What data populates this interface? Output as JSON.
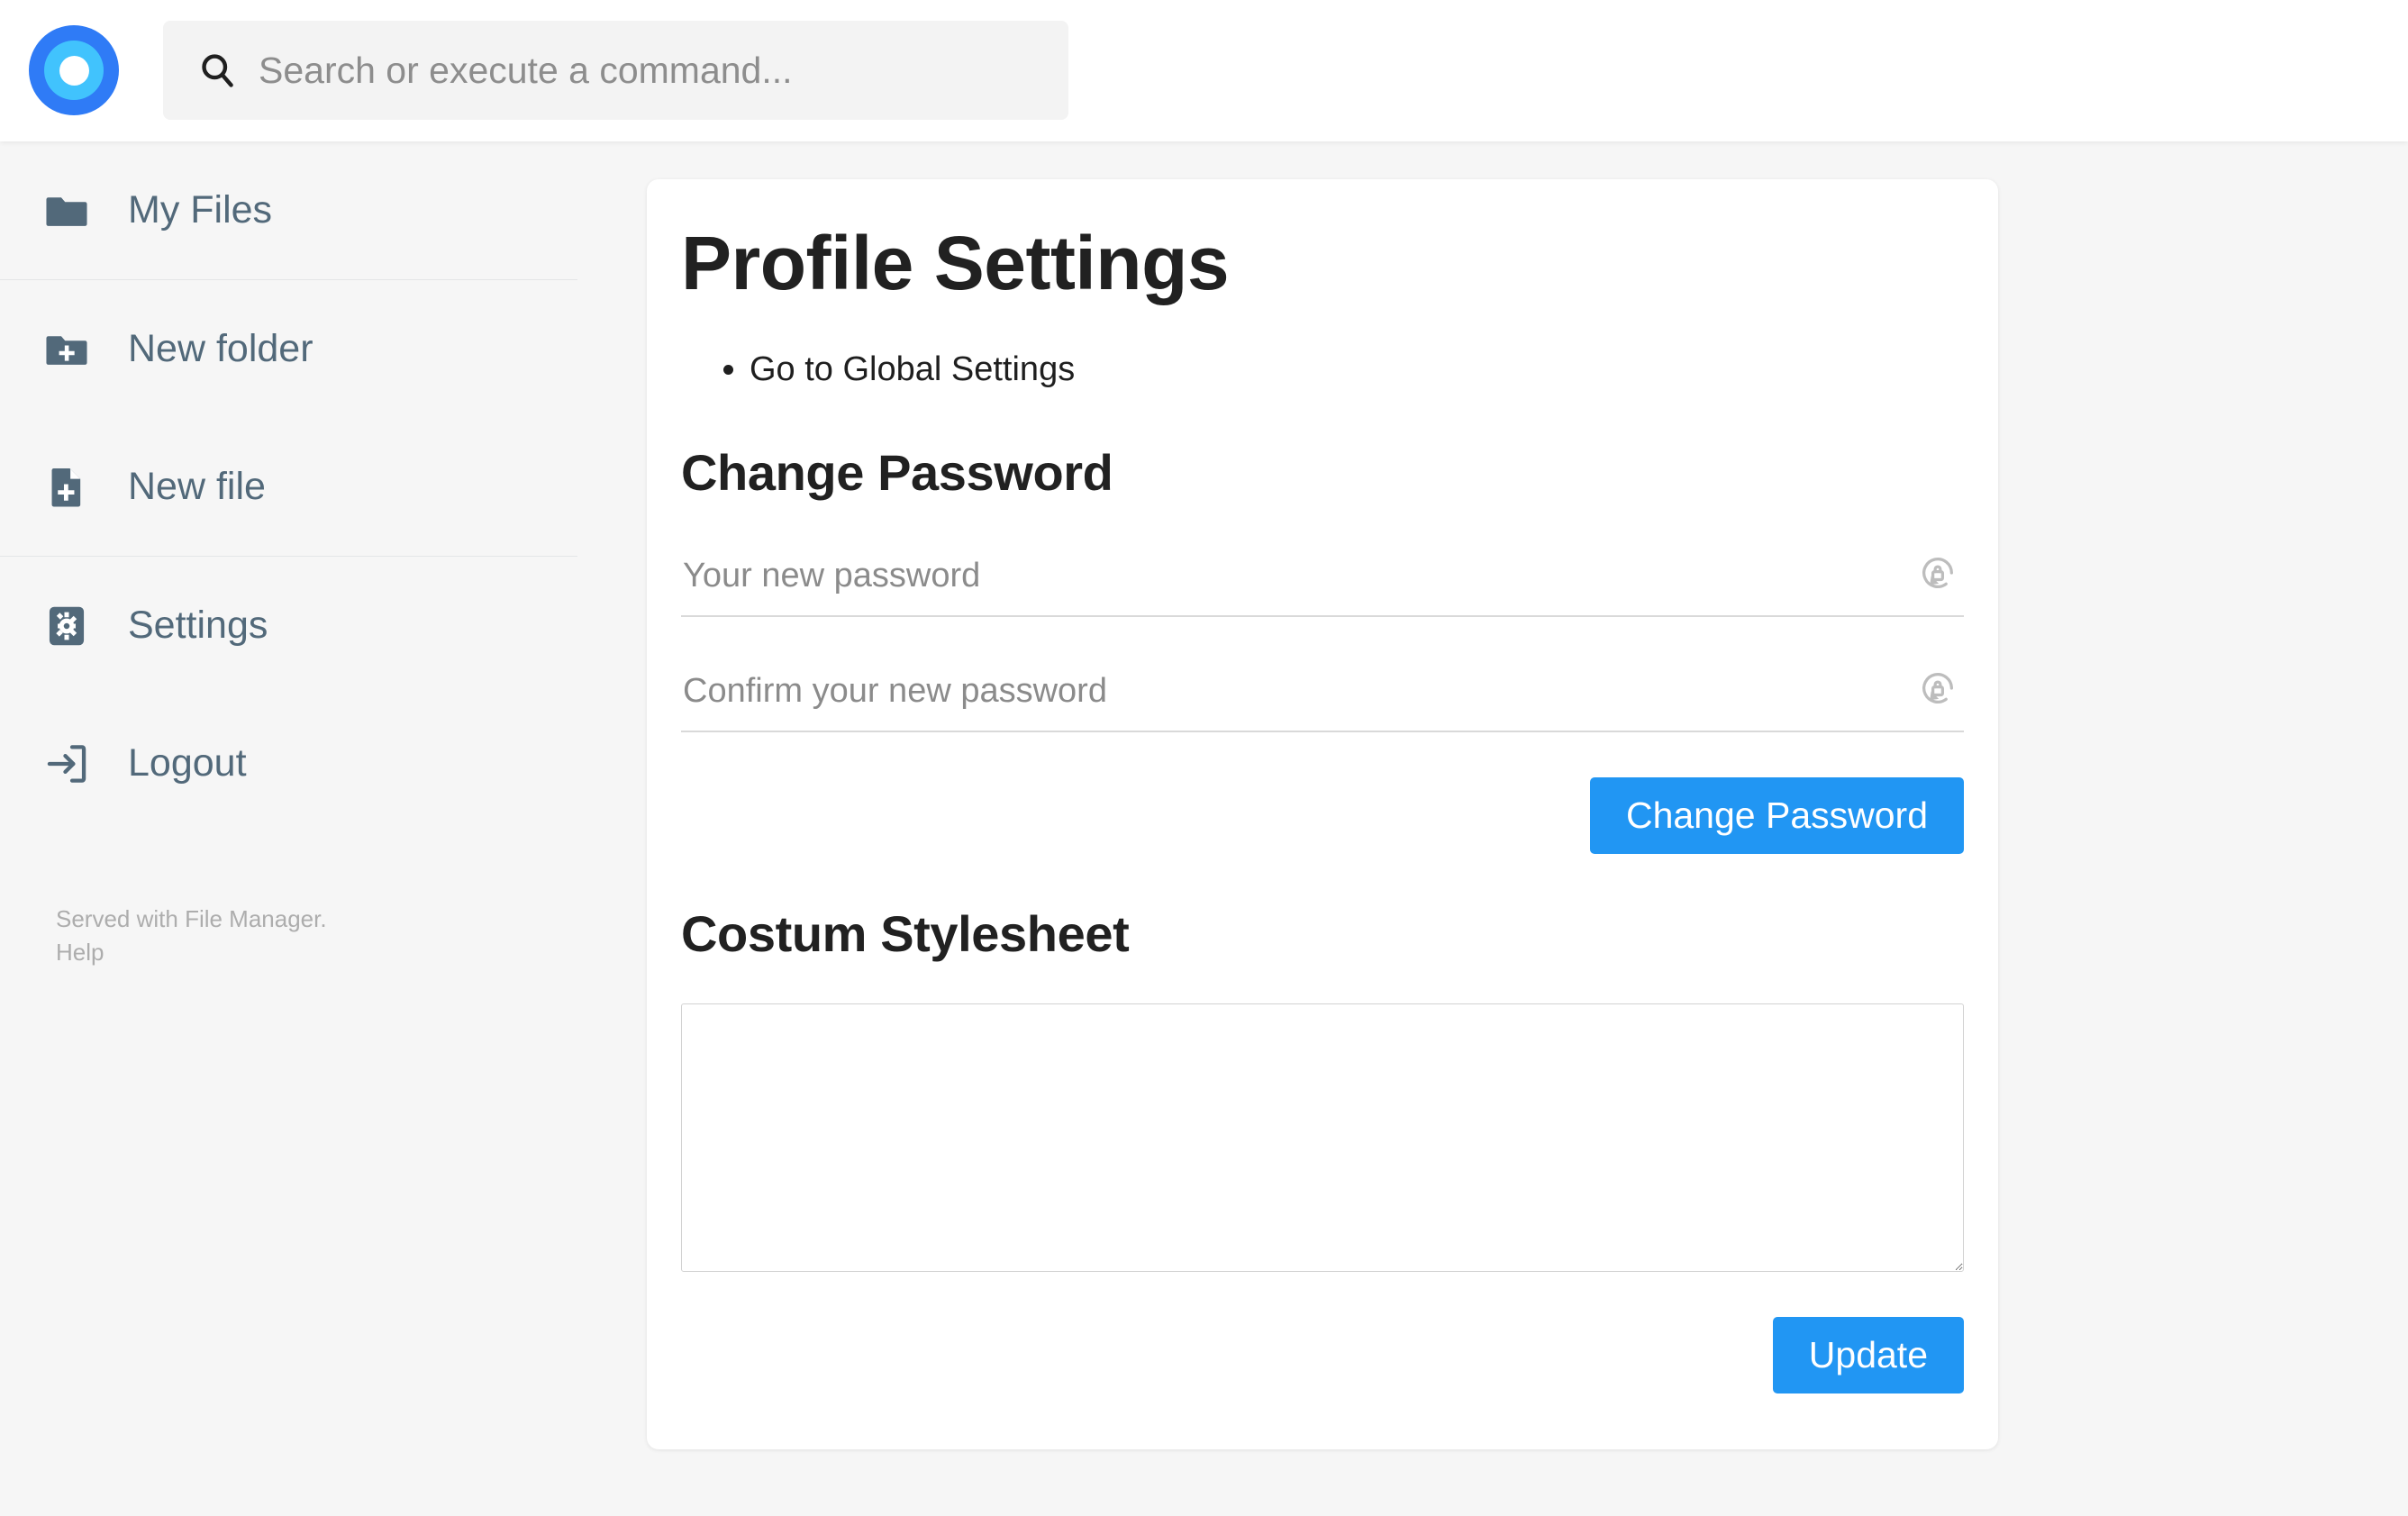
{
  "topbar": {
    "logo_name": "file-manager-logo",
    "logo_colors": {
      "outer_ring": "#2f7bf6",
      "inner_ring": "#41c3fd",
      "core": "#ffffff"
    },
    "search": {
      "placeholder": "Search or execute a command...",
      "value": "",
      "icon": "search-icon"
    }
  },
  "sidebar": {
    "items": [
      {
        "label": "My Files",
        "icon": "folder-icon"
      },
      {
        "label": "New folder",
        "icon": "folder-plus-icon"
      },
      {
        "label": "New file",
        "icon": "file-plus-icon"
      },
      {
        "label": "Settings",
        "icon": "gear-icon"
      },
      {
        "label": "Logout",
        "icon": "logout-icon"
      }
    ],
    "footer": {
      "served_with": "Served with File Manager.",
      "help": "Help"
    }
  },
  "main": {
    "page_title": "Profile Settings",
    "links": [
      {
        "label": "Go to Global Settings"
      }
    ],
    "change_password": {
      "heading": "Change Password",
      "new_password": {
        "placeholder": "Your new password",
        "value": "",
        "icon": "lock-reset-icon"
      },
      "confirm_password": {
        "placeholder": "Confirm your new password",
        "value": "",
        "icon": "lock-reset-icon"
      },
      "submit_label": "Change Password"
    },
    "stylesheet": {
      "heading": "Costum Stylesheet",
      "value": "",
      "placeholder": "",
      "submit_label": "Update"
    }
  },
  "colors": {
    "accent": "#2196f3",
    "page_background": "#f6f6f6",
    "card_background": "#ffffff",
    "sidebar_text": "#52697a",
    "heading_text": "#212121",
    "muted_text": "#adadad"
  }
}
